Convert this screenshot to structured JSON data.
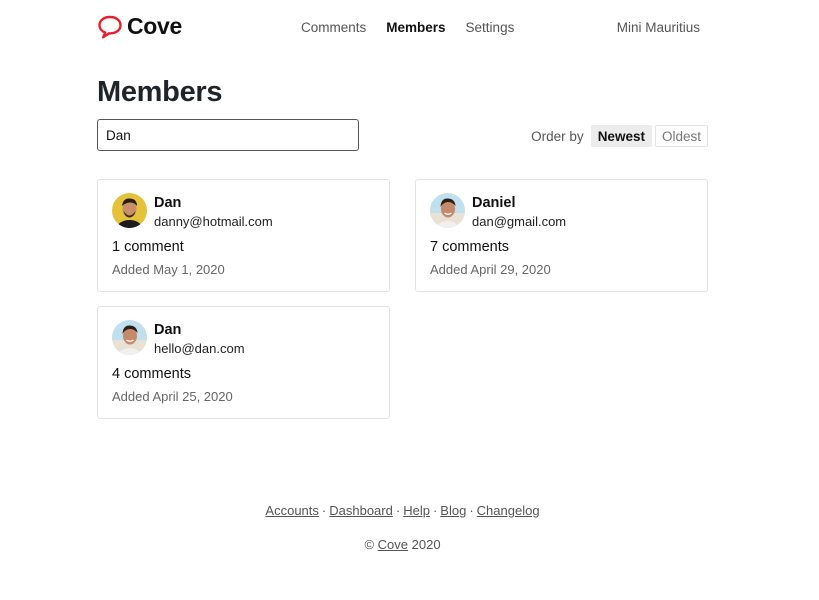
{
  "brand": {
    "name": "Cove",
    "icon": "speech-bubble-icon",
    "accent": "#e8202e"
  },
  "nav": {
    "items": [
      {
        "label": "Comments",
        "active": false
      },
      {
        "label": "Members",
        "active": true
      },
      {
        "label": "Settings",
        "active": false
      }
    ]
  },
  "account": {
    "name": "Mini Mauritius"
  },
  "page": {
    "title": "Members"
  },
  "search": {
    "value": "Dan",
    "placeholder": ""
  },
  "order": {
    "label": "Order by",
    "options": [
      {
        "label": "Newest",
        "active": true
      },
      {
        "label": "Oldest",
        "active": false
      }
    ]
  },
  "members": [
    {
      "name": "Dan",
      "email": "danny@hotmail.com",
      "comments": "1 comment",
      "added": "Added May 1, 2020",
      "avatar": "avatar-yellow"
    },
    {
      "name": "Daniel",
      "email": "dan@gmail.com",
      "comments": "7 comments",
      "added": "Added April 29, 2020",
      "avatar": "avatar-beach"
    },
    {
      "name": "Dan",
      "email": "hello@dan.com",
      "comments": "4 comments",
      "added": "Added April 25, 2020",
      "avatar": "avatar-beach"
    }
  ],
  "footer": {
    "links": [
      "Accounts",
      "Dashboard",
      "Help",
      "Blog",
      "Changelog"
    ],
    "separator": "·",
    "copyright_symbol": "©",
    "copyright_link": "Cove",
    "copyright_year": "2020"
  }
}
